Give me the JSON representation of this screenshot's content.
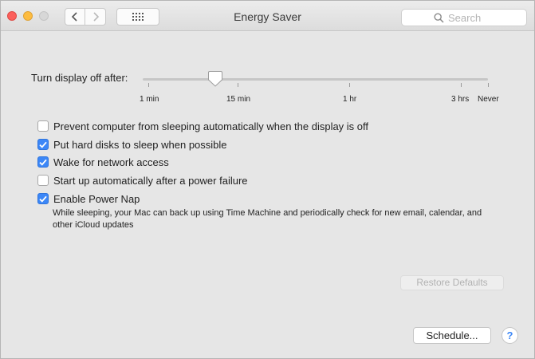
{
  "window": {
    "title": "Energy Saver"
  },
  "toolbar": {
    "back_icon": "chevron-left-icon",
    "forward_icon": "chevron-right-icon",
    "show_all_icon": "grid-icon"
  },
  "search": {
    "placeholder": "Search",
    "value": "",
    "icon": "search-icon"
  },
  "display_sleep": {
    "label": "Turn display off after:",
    "ticks": [
      "1 min",
      "15 min",
      "1 hr",
      "3 hrs",
      "Never"
    ],
    "current": "15 min"
  },
  "options": [
    {
      "label": "Prevent computer from sleeping automatically when the display is off",
      "checked": false
    },
    {
      "label": "Put hard disks to sleep when possible",
      "checked": true
    },
    {
      "label": "Wake for network access",
      "checked": true
    },
    {
      "label": "Start up automatically after a power failure",
      "checked": false
    },
    {
      "label": "Enable Power Nap",
      "checked": true
    }
  ],
  "power_nap_note": "While sleeping, your Mac can back up using Time Machine and periodically check for new email, calendar, and other iCloud updates",
  "buttons": {
    "restore_defaults": "Restore Defaults",
    "schedule": "Schedule...",
    "help": "?"
  },
  "colors": {
    "accent": "#3c87f7",
    "close": "#fc605c",
    "minimize": "#fdbc40"
  }
}
